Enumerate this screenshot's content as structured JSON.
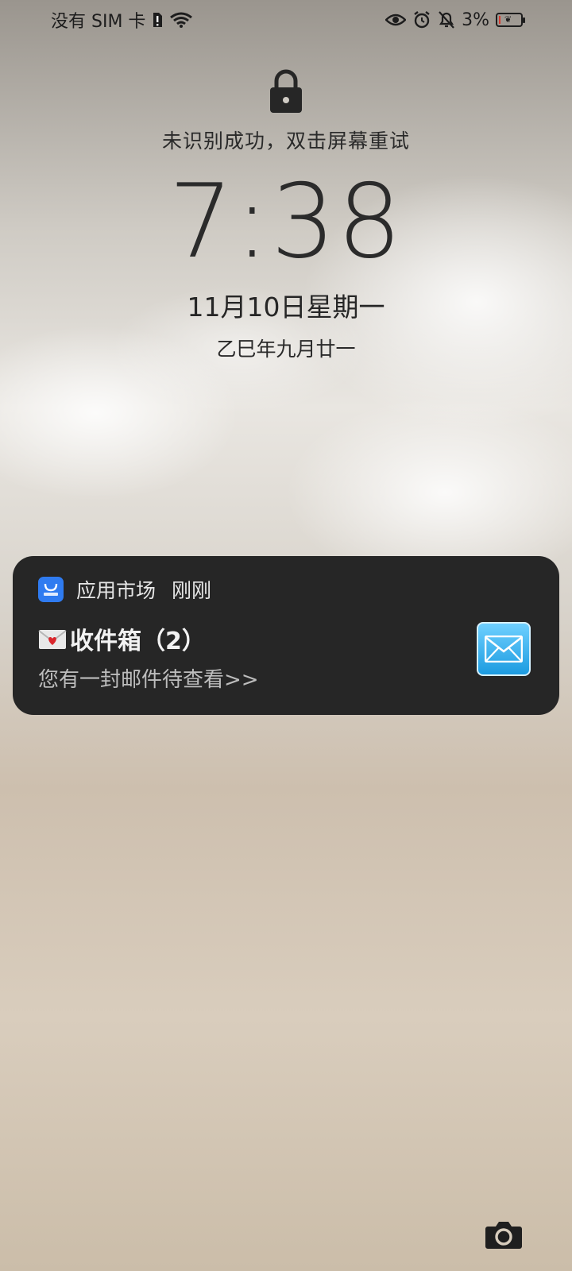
{
  "status_bar": {
    "carrier": "没有 SIM 卡",
    "battery_percent": "3%",
    "battery_level": 0.03
  },
  "lock": {
    "hint": "未识别成功，双击屏幕重试"
  },
  "clock": {
    "time": "7:38",
    "date": "11月10日星期一",
    "lunar": "乙巳年九月廿一"
  },
  "notification": {
    "app_name": "应用市场",
    "time": "刚刚",
    "title": "收件箱（2）",
    "body": "您有一封邮件待查看>>"
  },
  "icons": [
    "sim-alert-icon",
    "wifi-icon",
    "eye-icon",
    "alarm-icon",
    "mute-icon",
    "battery-icon",
    "lock-icon",
    "app-market-icon",
    "envelope-emoji-icon",
    "mail-thumbnail-icon",
    "camera-icon"
  ],
  "colors": {
    "notification_bg": "#262626",
    "app_icon_blue": "#2f7bf0",
    "battery_low": "#d83a2f",
    "mail_blue": "#1c9be0"
  }
}
